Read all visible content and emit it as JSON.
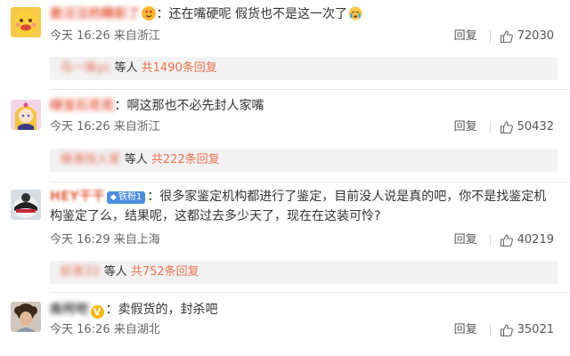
{
  "comments": [
    {
      "user_blurred": "是汪汪的精彩了",
      "text": "还在嘴硬呢 假货也不是这一次了",
      "time": "今天 16:26",
      "location": "来自浙江",
      "reply_label": "回复",
      "likes": "72030",
      "sub": {
        "names_blurred": "马一抹yc",
        "suffix": "等人",
        "count": "共1490条回复"
      }
    },
    {
      "user_blurred": "绿宝石花花",
      "text": "啊这那也不必先封人家嘴",
      "time": "今天 16:26",
      "location": "来自浙江",
      "reply_label": "回复",
      "likes": "50432",
      "sub": {
        "names_blurred": "晓港找人家",
        "suffix": "等人",
        "count": "共222条回复"
      }
    },
    {
      "user_blurred": "HEY干干",
      "badge": "铁粉1",
      "text": "很多家鉴定机构都进行了鉴定，目前没人说是真的吧，你不是找鉴定机构鉴定了么，结果呢，这都过去多少天了，现在在这装可怜?",
      "time": "今天 16:29",
      "location": "来自上海",
      "reply_label": "回复",
      "likes": "40219",
      "sub": {
        "names_blurred": "奶茶22",
        "suffix": "等人",
        "count": "共752条回复"
      }
    },
    {
      "user_blurred": "南柯吧",
      "text": "卖假货的，封杀吧",
      "time": "今天 16:26",
      "location": "来自湖北",
      "reply_label": "回复",
      "likes": "35021"
    }
  ],
  "colors": {
    "accent": "#eb7350",
    "badge_blue": "#4c8fde",
    "sub_bg": "#f2f2f2"
  },
  "icons": [
    "smile-face-avatar-icon",
    "heart-eyes-emoji-icon",
    "crying-face-emoji-icon",
    "thumbs-up-icon",
    "diamond-icon",
    "verified-v-icon"
  ]
}
